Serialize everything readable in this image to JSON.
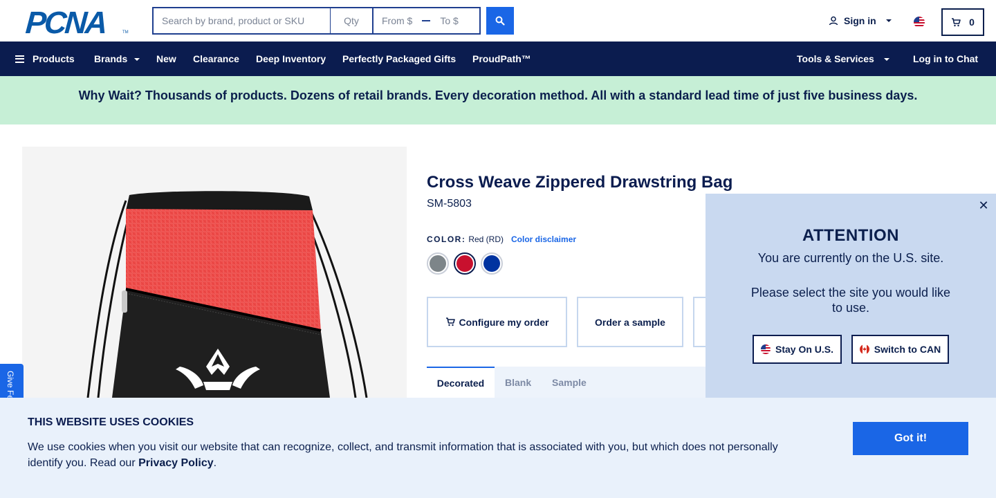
{
  "header": {
    "logo_text": "PCNA",
    "logo_tm": "TM",
    "search_placeholder": "Search by brand, product or SKU",
    "qty_placeholder": "Qty",
    "price_from_placeholder": "From $",
    "price_to_placeholder": "To $",
    "sign_in_label": "Sign in",
    "cart_count": "0"
  },
  "nav": {
    "items": [
      {
        "label": "Products"
      },
      {
        "label": "Brands"
      },
      {
        "label": "New"
      },
      {
        "label": "Clearance"
      },
      {
        "label": "Deep Inventory"
      },
      {
        "label": "Perfectly Packaged Gifts"
      },
      {
        "label": "ProudPath™"
      }
    ],
    "tools_label": "Tools & Services",
    "chat_label": "Log in to Chat"
  },
  "promo": {
    "text": "Why Wait? Thousands of products. Dozens of retail brands. Every decoration method. All with a standard lead time of just five business days."
  },
  "product": {
    "title": "Cross Weave Zippered Drawstring Bag",
    "sku": "SM-5803",
    "color_label": "COLOR:",
    "color_value": "Red (RD)",
    "color_disclaimer": "Color disclaimer",
    "swatches": [
      {
        "name": "Gray",
        "color": "#7d8589",
        "selected": false
      },
      {
        "name": "Red",
        "color": "#c8102e",
        "selected": true
      },
      {
        "name": "Royal Blue",
        "color": "#0033a0",
        "selected": false
      }
    ],
    "actions": {
      "configure_label": "Configure my order",
      "sample_label": "Order a sample"
    },
    "tabs": [
      {
        "label": "Decorated",
        "active": true
      },
      {
        "label": "Blank",
        "active": false
      },
      {
        "label": "Sample",
        "active": false
      }
    ]
  },
  "feedback": {
    "label": "Give Feedback"
  },
  "region_modal": {
    "heading": "ATTENTION",
    "line1": "You are currently on the U.S. site.",
    "line2": "Please select the site you would like to use.",
    "stay_label": "Stay On U.S.",
    "switch_label": "Switch to CAN",
    "close_symbol": "✕"
  },
  "cookie": {
    "title": "THIS WEBSITE USES COOKIES",
    "text": "We use cookies when you visit our website that can recognize, collect, and transmit information that is associated with you, but which does not personally identify you. Read our ",
    "link_label": "Privacy Policy",
    "text_end": ".",
    "button_label": "Got it!"
  },
  "colors": {
    "navy": "#0b1c4f",
    "accent_blue": "#1a66e6",
    "promo_green": "#c6efd6",
    "modal_bg": "#c9d9f0",
    "cookie_bg": "#e9f1fb"
  }
}
